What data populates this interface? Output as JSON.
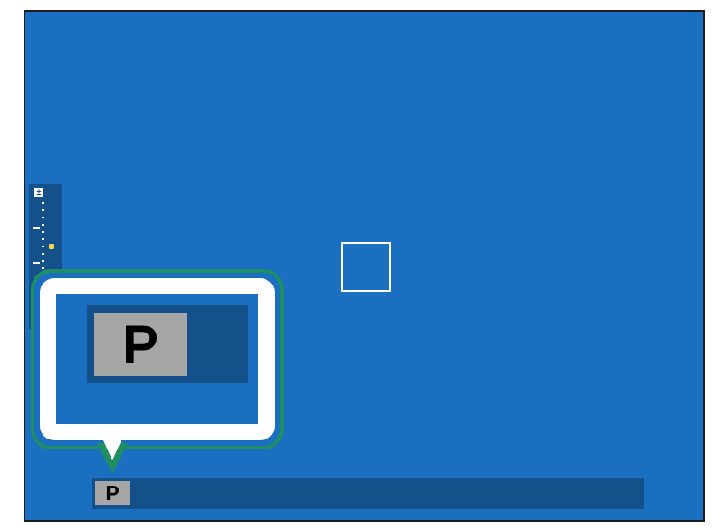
{
  "viewfinder": {
    "shooting_mode": "P",
    "callout_mode": "P",
    "exposure_icon": "exposure-compensation-icon",
    "exposure_level": 0
  },
  "colors": {
    "screen": "#1a6fc1",
    "bar": "#14508a",
    "callout_border": "#1f8f63",
    "indicator": "#f5d44b"
  }
}
